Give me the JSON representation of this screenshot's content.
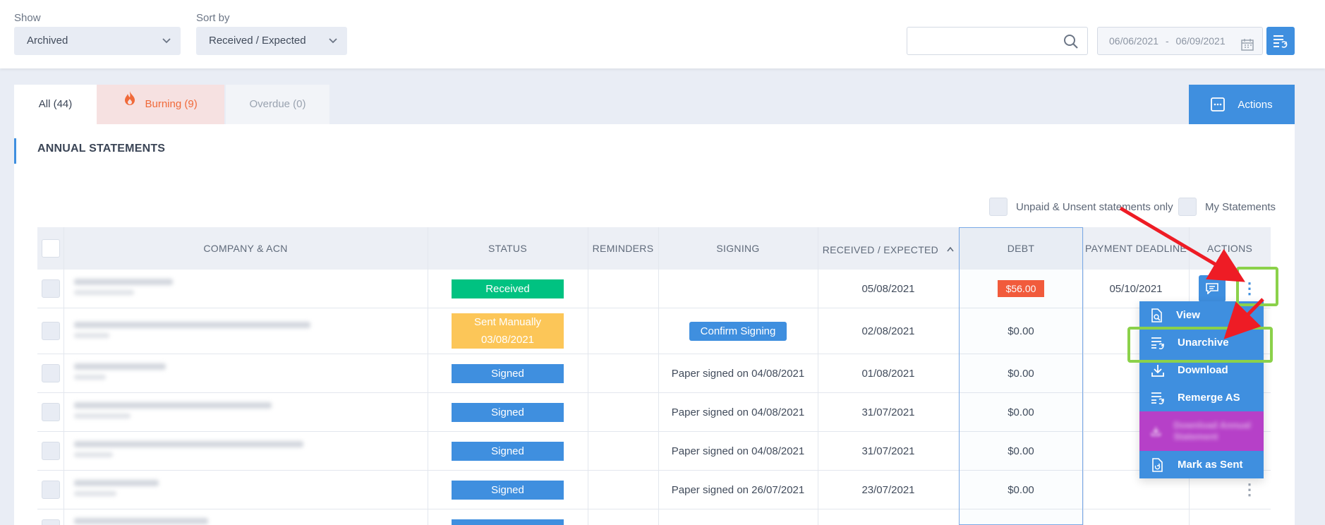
{
  "filters": {
    "show_label": "Show",
    "show_value": "Archived",
    "sort_label": "Sort by",
    "sort_value": "Received / Expected",
    "search_value": "",
    "date_from": "06/06/2021",
    "date_sep": "-",
    "date_to": "06/09/2021"
  },
  "tabs": [
    {
      "label": "All (44)"
    },
    {
      "label": "Burning (9)"
    },
    {
      "label": "Overdue (0)"
    }
  ],
  "actions_label": "Actions",
  "section_title": "ANNUAL STATEMENTS",
  "toggles": {
    "unpaid": "Unpaid & Unsent statements only",
    "mine": "My Statements"
  },
  "columns": {
    "company": "COMPANY & ACN",
    "status": "STATUS",
    "reminders": "REMINDERS",
    "signing": "SIGNING",
    "received": "RECEIVED / EXPECTED",
    "debt": "DEBT",
    "deadline": "PAYMENT DEADLINE",
    "actions": "ACTIONS"
  },
  "rows": [
    {
      "status": "Received",
      "signing": "",
      "received": "05/08/2021",
      "debt": "$56.00",
      "deadline": "05/10/2021"
    },
    {
      "status_line1": "Sent Manually",
      "status_line2": "03/08/2021",
      "signing": "Confirm Signing",
      "received": "02/08/2021",
      "debt": "$0.00"
    },
    {
      "status": "Signed",
      "signing": "Paper signed on 04/08/2021",
      "received": "01/08/2021",
      "debt": "$0.00"
    },
    {
      "status": "Signed",
      "signing": "Paper signed on 04/08/2021",
      "received": "31/07/2021",
      "debt": "$0.00"
    },
    {
      "status": "Signed",
      "signing": "Paper signed on 04/08/2021",
      "received": "31/07/2021",
      "debt": "$0.00"
    },
    {
      "status": "Signed",
      "signing": "Paper signed on 26/07/2021",
      "received": "23/07/2021",
      "debt": "$0.00"
    }
  ],
  "menu": {
    "view": "View",
    "unarchive": "Unarchive",
    "download": "Download",
    "remerge": "Remerge AS",
    "download_annual": "Download Annual Statement",
    "mark_sent": "Mark as Sent"
  },
  "colors": {
    "accent": "#3f8fdf",
    "received": "#00c281",
    "sent_manually": "#fcc658",
    "debt": "#f55a3a",
    "burning": "#f06a3a",
    "highlight": "#8bd14a",
    "arrow": "#ee1c25"
  }
}
